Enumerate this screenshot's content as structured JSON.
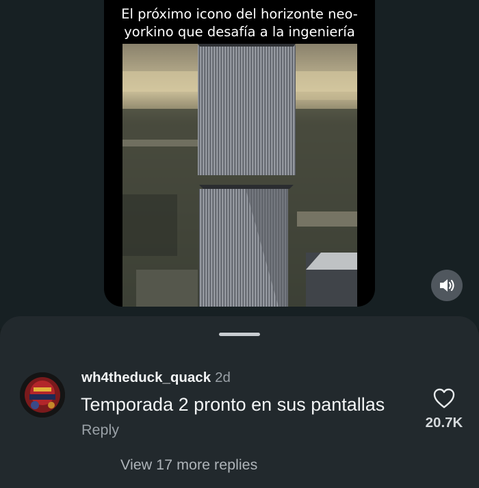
{
  "video": {
    "caption": "El próximo icono del horizonte neo-yorkino que desafía a la ingeniería",
    "sound_icon": "volume-icon"
  },
  "comments_sheet": {
    "handle_icon": "drag-handle",
    "comment": {
      "username": "wh4theduck_quack",
      "timestamp": "2d",
      "text": "Temporada 2 pronto en sus pantallas",
      "reply_label": "Reply",
      "like_icon": "heart-outline-icon",
      "like_count": "20.7K",
      "avatar_icon": "helmet-avatar"
    },
    "view_replies_label": "View 17 more replies"
  },
  "colors": {
    "background": "#161d1f",
    "sheet": "#22292d",
    "primary_text": "#f3f5f6",
    "secondary_text": "#9aa1a7"
  }
}
